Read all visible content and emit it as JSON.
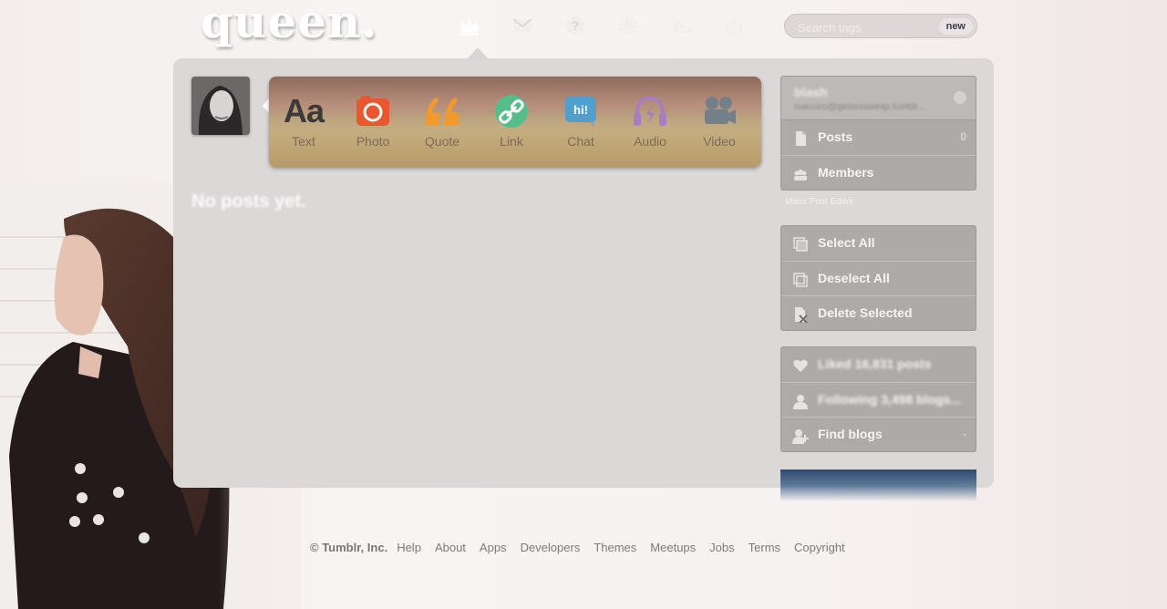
{
  "header": {
    "logo": "queen.",
    "nav_icons": [
      "crown-icon",
      "mail-icon",
      "help-icon",
      "gear-icon",
      "e-icon",
      "power-icon"
    ],
    "search": {
      "placeholder": "Search tags",
      "new_label": "new"
    }
  },
  "post_types": [
    {
      "label": "Text",
      "glyph": "Aa",
      "icon": "text-icon",
      "color": "#3c3a38"
    },
    {
      "label": "Photo",
      "icon": "camera-icon",
      "color": "#e8572e"
    },
    {
      "label": "Quote",
      "icon": "quote-icon",
      "color": "#f2992e"
    },
    {
      "label": "Link",
      "icon": "link-icon",
      "color": "#56bc8a"
    },
    {
      "label": "Chat",
      "glyph": "hi!",
      "icon": "chat-icon",
      "color": "#529ecc"
    },
    {
      "label": "Audio",
      "icon": "headphones-icon",
      "color": "#a77dc2"
    },
    {
      "label": "Video",
      "icon": "video-camera-icon",
      "color": "#748089"
    }
  ],
  "main": {
    "empty_message": "No posts yet."
  },
  "sidebar": {
    "blog": {
      "name": "blash",
      "url": "cuecoco@girlsessweap.tumblr..."
    },
    "items": [
      {
        "label": "Posts",
        "count": "0",
        "icon": "document-icon"
      },
      {
        "label": "Members",
        "icon": "members-icon"
      }
    ],
    "mass_post_editor_label": "Mass Post Editor",
    "editor_items": [
      {
        "label": "Select All",
        "icon": "select-all-icon"
      },
      {
        "label": "Deselect All",
        "icon": "deselect-all-icon"
      },
      {
        "label": "Delete Selected",
        "icon": "delete-selected-icon"
      }
    ],
    "account_items": [
      {
        "label": "Liked 16,831 posts",
        "icon": "heart-icon"
      },
      {
        "label": "Following 3,498 blogs...",
        "icon": "person-icon"
      },
      {
        "label": "Find blogs",
        "icon": "add-person-icon",
        "count": "-"
      }
    ]
  },
  "footer": {
    "copyright": "© Tumblr, Inc.",
    "links": [
      "Help",
      "About",
      "Apps",
      "Developers",
      "Themes",
      "Meetups",
      "Jobs",
      "Terms",
      "Copyright"
    ]
  },
  "colors": {
    "panel": "#dcd8d8",
    "sidebar_item": "#aeaaaa",
    "accent_blue": "#2c4a6e"
  }
}
